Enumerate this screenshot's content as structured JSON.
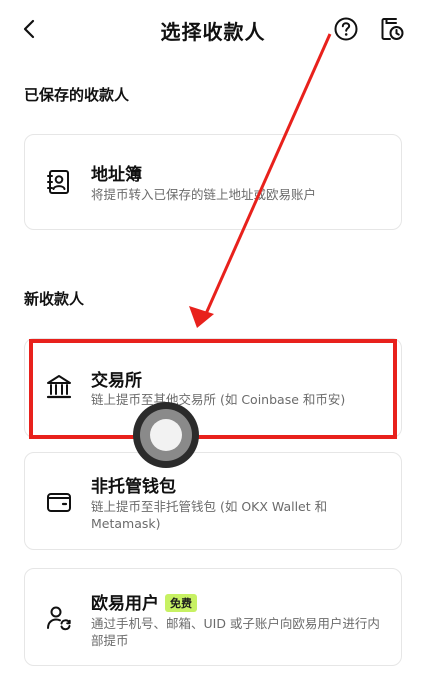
{
  "header": {
    "title": "选择收款人",
    "back_icon": "chevron-left-icon",
    "help_icon": "question-circle-icon",
    "history_icon": "document-clock-icon"
  },
  "saved_section": {
    "label": "已保存的收款人",
    "address_book": {
      "name": "地址簿",
      "desc": "将提币转入已保存的链上地址或欧易账户",
      "icon": "address-book-icon"
    }
  },
  "new_section": {
    "label": "新收款人",
    "items": [
      {
        "name": "交易所",
        "desc": "链上提币至其他交易所 (如 Coinbase 和币安)",
        "icon": "bank-building-icon"
      },
      {
        "name": "非托管钱包",
        "desc": "链上提币至非托管钱包 (如 OKX Wallet 和 Metamask)",
        "icon": "wallet-icon"
      },
      {
        "name": "欧易用户",
        "badge": "免费",
        "desc": "通过手机号、邮箱、UID 或子账户向欧易用户进行内部提币",
        "icon": "user-transfer-icon"
      }
    ]
  },
  "colors": {
    "highlight": "#e8211c",
    "badge_bg": "#c7f163",
    "text_secondary": "#6b6b6b"
  }
}
